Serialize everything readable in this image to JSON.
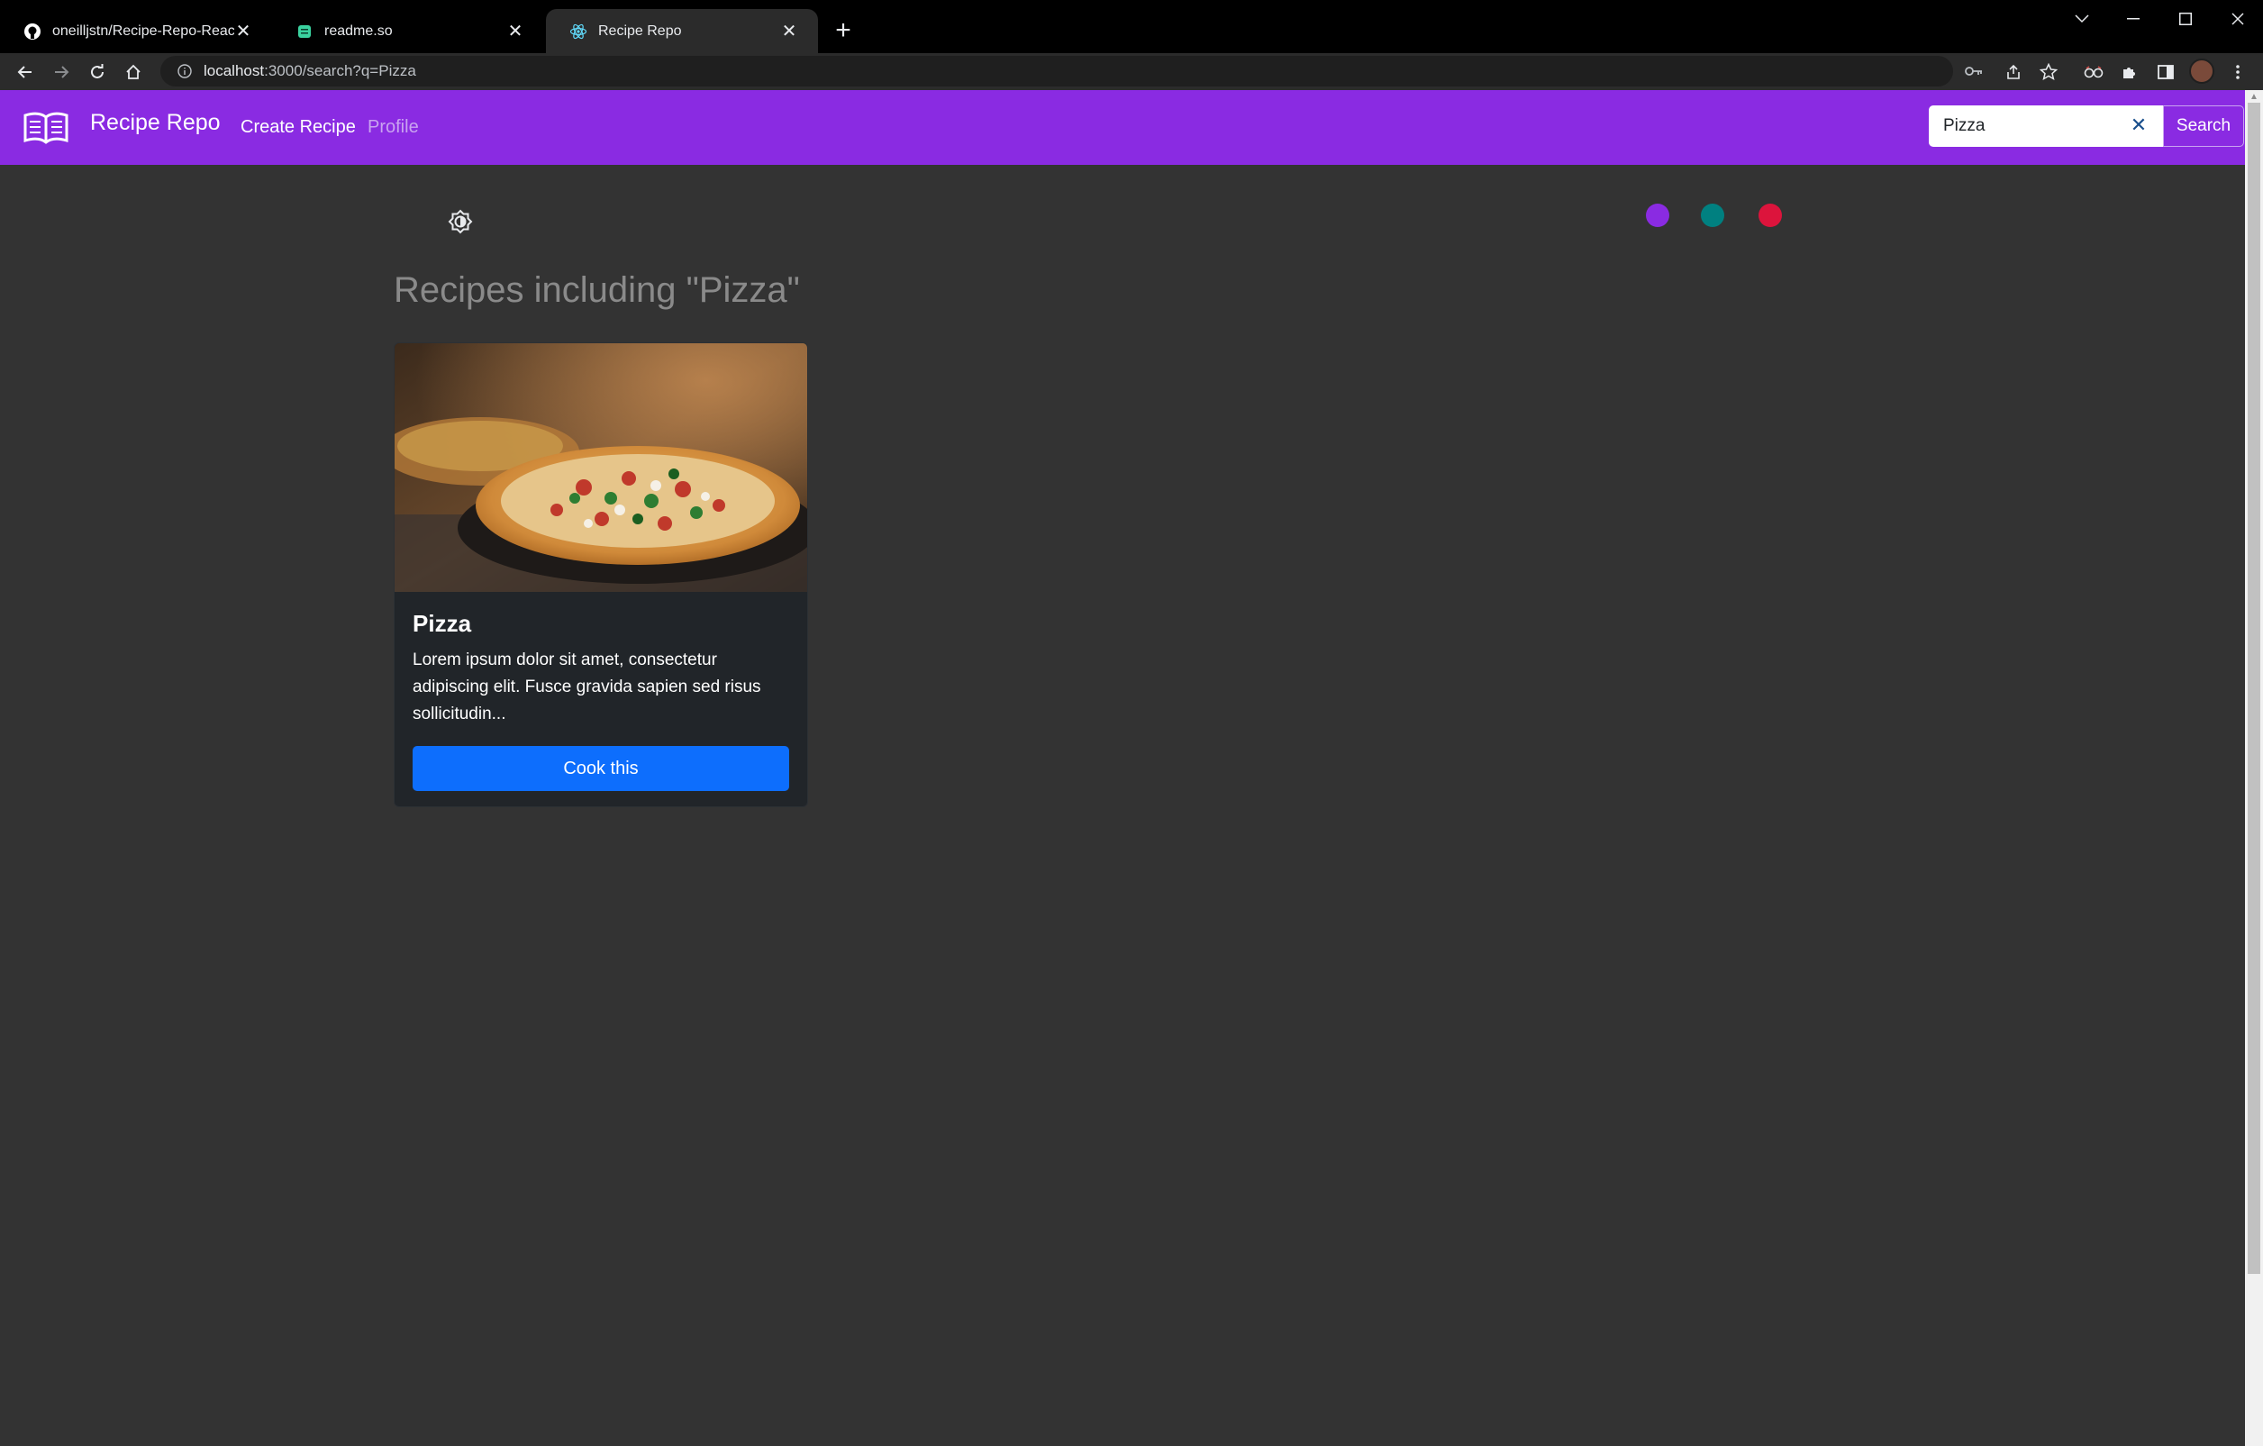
{
  "browser": {
    "tabs": [
      {
        "title": "oneilljstn/Recipe-Repo-React",
        "icon": "github-icon",
        "active": false
      },
      {
        "title": "readme.so",
        "icon": "readme-icon",
        "active": false
      },
      {
        "title": "Recipe Repo",
        "icon": "react-icon",
        "active": true
      }
    ],
    "url_host": "localhost",
    "url_rest": ":3000/search?q=Pizza"
  },
  "app": {
    "brand": "Recipe Repo",
    "nav": {
      "create_recipe": "Create Recipe",
      "profile": "Profile"
    },
    "search": {
      "value": "Pizza",
      "button": "Search"
    },
    "theme_colors": [
      "#8a2be2",
      "#008080",
      "#dc143c"
    ],
    "heading": "Recipes including \"Pizza\"",
    "results": [
      {
        "title": "Pizza",
        "description": "Lorem ipsum dolor sit amet, consectetur adipiscing elit. Fusce gravida sapien sed risus sollicitudin...",
        "button": "Cook this"
      }
    ]
  },
  "colors": {
    "navbar": "#8a2be2",
    "background": "#333333",
    "card": "#212529",
    "primary_button": "#0d6efd"
  }
}
